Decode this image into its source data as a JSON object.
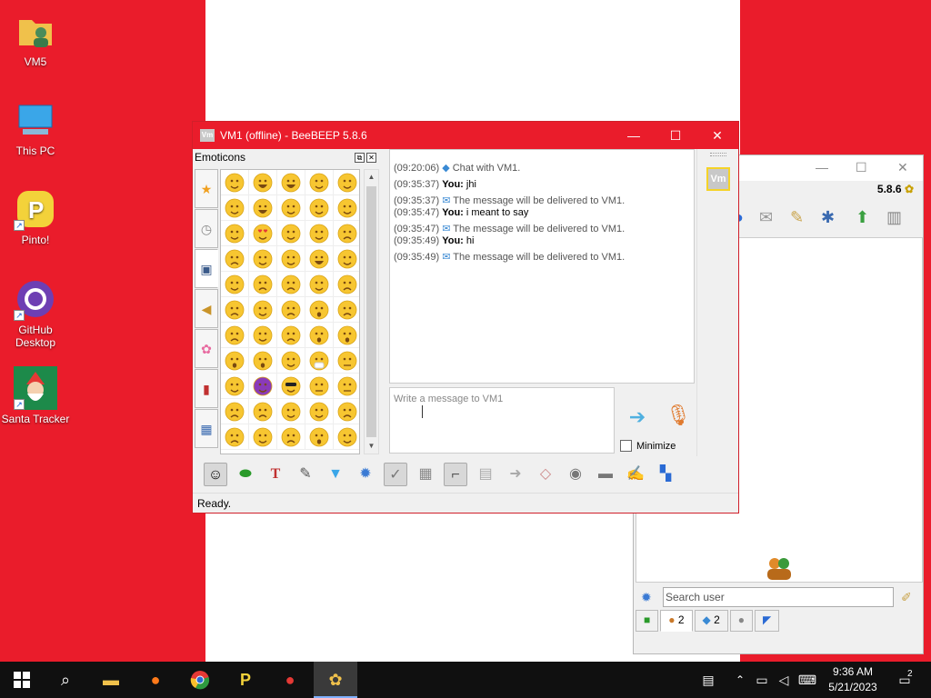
{
  "desktop": {
    "icons": [
      {
        "label": "VM5"
      },
      {
        "label": "This PC"
      },
      {
        "label": "Pinto!"
      },
      {
        "label": "GitHub Desktop"
      },
      {
        "label": "Santa Tracker"
      }
    ]
  },
  "mainwin": {
    "version": "5.8.6",
    "search_placeholder": "Search user",
    "tabs": [
      {
        "icon": "users-icon",
        "count": "2"
      },
      {
        "icon": "chat-icon",
        "count": "2"
      }
    ]
  },
  "chat": {
    "app_icon_text": "Vm",
    "title": "VM1 (offline) - BeeBEEP 5.8.6",
    "emoticons_header": "Emoticons",
    "avatar_text": "Vm",
    "history": [
      {
        "time": "(09:20:06)",
        "kind": "system",
        "text": "Chat with VM1."
      },
      {
        "time": "(09:35:37)",
        "kind": "you",
        "who": "You:",
        "text": "jhi"
      },
      {
        "time": "(09:35:37)",
        "kind": "system",
        "text": "The message will be delivered to VM1."
      },
      {
        "time": "(09:35:47)",
        "kind": "you",
        "who": "You:",
        "text": "i meant to say"
      },
      {
        "time": "(09:35:47)",
        "kind": "system",
        "text": "The message will be delivered to VM1."
      },
      {
        "time": "(09:35:49)",
        "kind": "you",
        "who": "You:",
        "text": "hi"
      },
      {
        "time": "(09:35:49)",
        "kind": "system",
        "text": "The message will be delivered to VM1."
      }
    ],
    "compose_placeholder": "Write a message to VM1",
    "minimize_label": "Minimize",
    "status": "Ready."
  },
  "taskbar": {
    "time": "9:36 AM",
    "date": "5/21/2023",
    "notifications": "2"
  },
  "colors": {
    "accent": "#ea1c2b",
    "avatar_border": "#f5d327"
  }
}
